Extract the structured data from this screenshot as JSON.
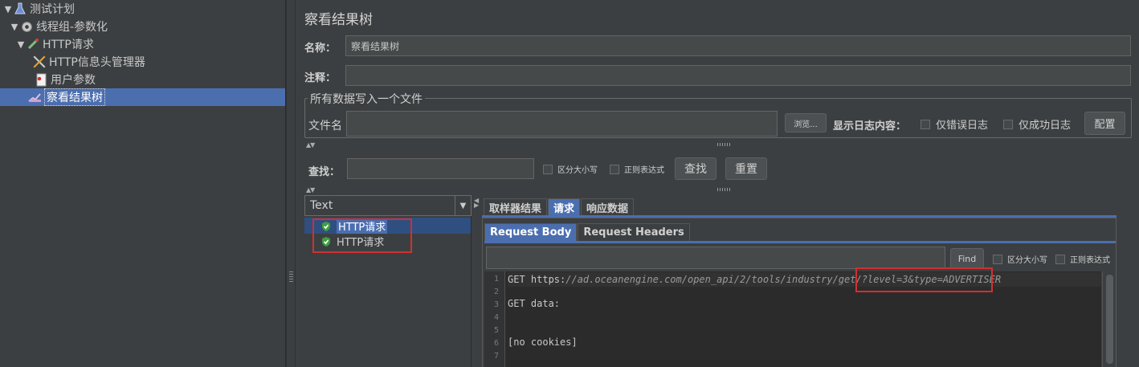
{
  "tree": {
    "items": [
      {
        "label": "测试计划",
        "icon": "flask-icon",
        "level": 0
      },
      {
        "label": "线程组-参数化",
        "icon": "gear-icon",
        "level": 1
      },
      {
        "label": "HTTP请求",
        "icon": "pipette-icon",
        "level": 2
      },
      {
        "label": "HTTP信息头管理器",
        "icon": "tools-icon",
        "level": 3
      },
      {
        "label": "用户参数",
        "icon": "document-icon",
        "level": 3
      },
      {
        "label": "察看结果树",
        "icon": "chart-icon",
        "level": 2,
        "selected": true
      }
    ]
  },
  "panel": {
    "title": "察看结果树",
    "name_label": "名称：",
    "name_value": "察看结果树",
    "comment_label": "注释：",
    "comment_value": "",
    "file_section_title": "所有数据写入一个文件",
    "file_label": "文件名",
    "file_value": "",
    "browse_label": "浏览...",
    "log_label": "显示日志内容：",
    "errors_only_label": "仅错误日志",
    "success_only_label": "仅成功日志",
    "configure_label": "配置"
  },
  "search": {
    "label": "查找：",
    "value": "",
    "case_label": "区分大小写",
    "regex_label": "正则表达式",
    "find_label": "查找",
    "reset_label": "重置"
  },
  "results": {
    "renderer": "Text",
    "samples": [
      {
        "label": "HTTP请求",
        "status": "success",
        "selected": true
      },
      {
        "label": "HTTP请求",
        "status": "success",
        "selected": false
      }
    ]
  },
  "detail_tabs": [
    "取样器结果",
    "请求",
    "响应数据"
  ],
  "detail_active_tab": 1,
  "request_tabs": [
    "Request Body",
    "Request Headers"
  ],
  "request_active_tab": 0,
  "find_bar": {
    "value": "",
    "find_label": "Find",
    "case_label": "区分大小写",
    "regex_label": "正则表达式"
  },
  "code": {
    "line_numbers": [
      "1",
      "2",
      "3",
      "4",
      "5",
      "6",
      "7"
    ],
    "line1_prefix": "GET https:",
    "line1_url": "//ad.oceanengine.com/open_api/2/tools/industry/get/?level=3&type=ADVERTISER",
    "line3": "GET data:",
    "line6": "[no cookies]"
  },
  "colors": {
    "background": "#3c3f41",
    "selection": "#4b6eaf",
    "highlight_box": "#d03030",
    "success_icon": "#3ea03e"
  }
}
